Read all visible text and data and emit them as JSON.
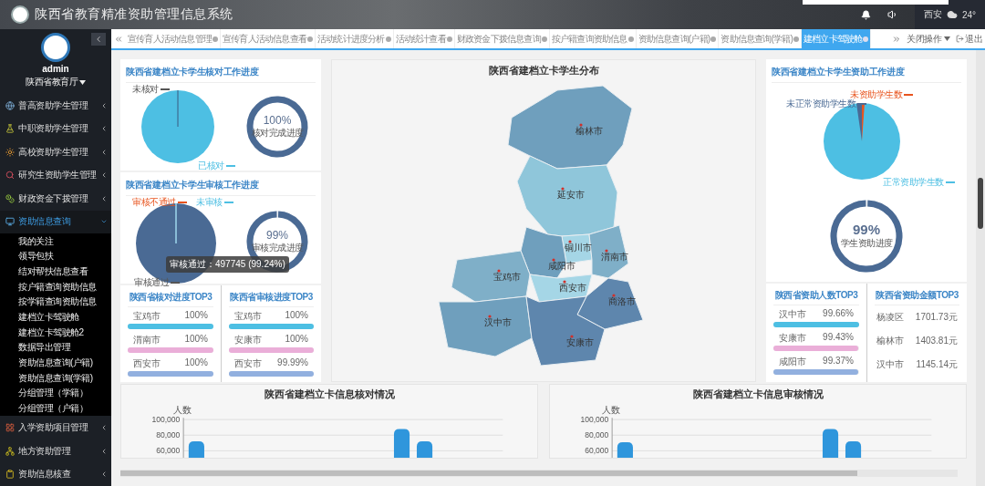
{
  "header": {
    "title": "陕西省教育精准资助管理信息系统",
    "city": "西安",
    "temperature": "24°"
  },
  "user": {
    "name": "admin",
    "org": "陕西省教育厅"
  },
  "menu": [
    {
      "label": "普高资助学生管理",
      "expanded": false
    },
    {
      "label": "中职资助学生管理",
      "expanded": false
    },
    {
      "label": "高校资助学生管理",
      "expanded": false
    },
    {
      "label": "研究生资助学生管理",
      "expanded": false
    },
    {
      "label": "财政资金下拨管理",
      "expanded": false
    },
    {
      "label": "资助信息查询",
      "expanded": true,
      "children": [
        {
          "label": "我的关注"
        },
        {
          "label": "领导包扶"
        },
        {
          "label": "结对帮扶信息查看"
        },
        {
          "label": "按户籍查询资助信息"
        },
        {
          "label": "按学籍查询资助信息"
        },
        {
          "label": "建档立卡驾驶舱"
        },
        {
          "label": "建档立卡驾驶舱2"
        },
        {
          "label": "数据导出管理"
        },
        {
          "label": "资助信息查询(户籍)"
        },
        {
          "label": "资助信息查询(学籍)"
        },
        {
          "label": "分组管理（学籍）"
        },
        {
          "label": "分组管理（户籍）"
        }
      ]
    },
    {
      "label": "入学资助项目管理",
      "expanded": false
    },
    {
      "label": "地方资助管理",
      "expanded": false
    },
    {
      "label": "资助信息核查",
      "expanded": false
    }
  ],
  "tabs": [
    {
      "label": "宣传育人活动信息管理",
      "selected": false
    },
    {
      "label": "宣传育人活动信息查看",
      "selected": false
    },
    {
      "label": "活动统计进度分析",
      "selected": false
    },
    {
      "label": "活动统计查看",
      "selected": false
    },
    {
      "label": "财政资金下拨信息查询",
      "selected": false
    },
    {
      "label": "按户籍查询资助信息",
      "selected": false
    },
    {
      "label": "资助信息查询(户籍)",
      "selected": false
    },
    {
      "label": "资助信息查询(学籍)",
      "selected": false
    },
    {
      "label": "建档立卡驾驶舱",
      "selected": true
    }
  ],
  "tab_controls": {
    "close_menu": "关闭操作",
    "logout": "退出"
  },
  "check_panel": {
    "title": "陕西省建档立卡学生核对工作进度",
    "pie_labels": [
      {
        "text": "未核对",
        "color": "#555555"
      },
      {
        "text": "已核对",
        "color": "#4dbfe3"
      }
    ],
    "donut": {
      "value": "100%",
      "label": "核对完成进度",
      "level": 1
    }
  },
  "review_panel": {
    "title": "陕西省建档立卡学生审核工作进度",
    "pie_labels": [
      {
        "text": "审核不通过",
        "color": "#e8541e"
      },
      {
        "text": "未审核",
        "color": "#4dbfe3"
      },
      {
        "text": "审核通过",
        "color": "#555555"
      }
    ],
    "donut": {
      "value": "99%",
      "label": "审核完成进度",
      "level": 0.99
    },
    "tooltip": "审核通过：497745 (99.24%)"
  },
  "left_top3": [
    {
      "kind": "bar",
      "title": "陕西省核对进度TOP3",
      "rows": [
        {
          "name": "宝鸡市",
          "value": "100%",
          "level": 1,
          "color": "#4dbfe3"
        },
        {
          "name": "渭南市",
          "value": "100%",
          "level": 1,
          "color": "#eaaed8"
        },
        {
          "name": "西安市",
          "value": "100%",
          "level": 1,
          "color": "#92b0df"
        }
      ]
    },
    {
      "kind": "bar",
      "title": "陕西省审核进度TOP3",
      "rows": [
        {
          "name": "宝鸡市",
          "value": "100%",
          "level": 1,
          "color": "#4dbfe3"
        },
        {
          "name": "安康市",
          "value": "100%",
          "level": 1,
          "color": "#eaaed8"
        },
        {
          "name": "西安市",
          "value": "99.99%",
          "level": 0.9999,
          "color": "#92b0df"
        }
      ]
    }
  ],
  "map": {
    "title": "陕西省建档立卡学生分布",
    "cities": [
      {
        "name": "榆林市",
        "color": "#6f9fbd"
      },
      {
        "name": "延安市",
        "color": "#8fc6da"
      },
      {
        "name": "铜川市",
        "color": "#a5d6e6"
      },
      {
        "name": "渭南市",
        "color": "#7fafc8"
      },
      {
        "name": "咸阳市",
        "color": "#6f9fbd"
      },
      {
        "name": "宝鸡市",
        "color": "#7fafc8"
      },
      {
        "name": "西安市",
        "color": "#a5d6e6"
      },
      {
        "name": "商洛市",
        "color": "#5e86ad"
      },
      {
        "name": "汉中市",
        "color": "#6f9fbd"
      },
      {
        "name": "安康市",
        "color": "#5e86ad"
      }
    ]
  },
  "aid_panel": {
    "title": "陕西省建档立卡学生资助工作进度",
    "pie_labels": [
      {
        "text": "未资助学生数",
        "color": "#e8541e"
      },
      {
        "text": "未正常资助学生数",
        "color": "#4a6a94"
      },
      {
        "text": "正常资助学生数",
        "color": "#4dbfe3"
      }
    ],
    "donut": {
      "value": "99%",
      "label": "学生资助进度",
      "level": 0.99
    }
  },
  "right_top3": [
    {
      "kind": "bar",
      "title": "陕西省资助人数TOP3",
      "rows": [
        {
          "name": "汉中市",
          "value": "99.66%",
          "level": 0.9966,
          "color": "#4dbfe3"
        },
        {
          "name": "安康市",
          "value": "99.43%",
          "level": 0.9943,
          "color": "#eaaed8"
        },
        {
          "name": "咸阳市",
          "value": "99.37%",
          "level": 0.9937,
          "color": "#92b0df"
        }
      ]
    },
    {
      "kind": "plain",
      "title": "陕西省资助金额TOP3",
      "rows": [
        {
          "name": "杨凌区",
          "value": "1701.73元"
        },
        {
          "name": "榆林市",
          "value": "1403.81元"
        },
        {
          "name": "汉中市",
          "value": "1145.14元"
        }
      ]
    }
  ],
  "charts": [
    {
      "chart_data": {
        "type": "bar",
        "title": "陕西省建档立卡信息核对情况",
        "ylabel": "人数",
        "values": [
          72000,
          null,
          null,
          null,
          null,
          null,
          null,
          null,
          null,
          88000,
          72000,
          null,
          null,
          null
        ],
        "ylim": [
          60000,
          100000
        ],
        "yticks": [
          {
            "value": 60000,
            "label": "60,000"
          },
          {
            "value": 80000,
            "label": "80,000"
          },
          {
            "value": 100000,
            "label": "100,000"
          }
        ]
      }
    },
    {
      "chart_data": {
        "type": "bar",
        "title": "陕西省建档立卡信息审核情况",
        "ylabel": "人数",
        "values": [
          71000,
          null,
          null,
          null,
          null,
          null,
          null,
          null,
          null,
          88000,
          72000,
          null,
          null,
          null
        ],
        "ylim": [
          60000,
          100000
        ],
        "yticks": [
          {
            "value": 60000,
            "label": "60,000"
          },
          {
            "value": 80000,
            "label": "80,000"
          },
          {
            "value": 100000,
            "label": "100,000"
          }
        ]
      }
    }
  ]
}
